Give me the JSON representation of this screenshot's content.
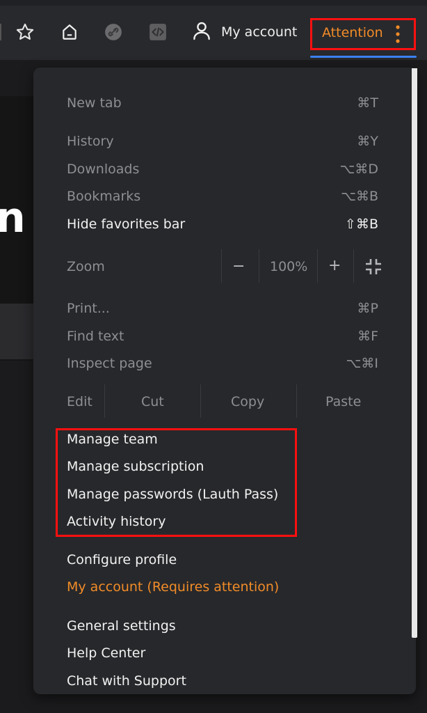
{
  "toolbar": {
    "account_label": "My account",
    "attention_label": "Attention"
  },
  "page": {
    "glyph": "n"
  },
  "menu": {
    "new_tab": {
      "label": "New tab",
      "shortcut": "⌘T"
    },
    "history": {
      "label": "History",
      "shortcut": "⌘Y"
    },
    "downloads": {
      "label": "Downloads",
      "shortcut": "⌥⌘D"
    },
    "bookmarks": {
      "label": "Bookmarks",
      "shortcut": "⌥⌘B"
    },
    "hide_favorites": {
      "label": "Hide favorites bar",
      "shortcut": "⇧⌘B"
    },
    "zoom": {
      "label": "Zoom",
      "minus": "−",
      "value": "100%",
      "plus": "+"
    },
    "print": {
      "label": "Print...",
      "shortcut": "⌘P"
    },
    "find": {
      "label": "Find text",
      "shortcut": "⌘F"
    },
    "inspect": {
      "label": "Inspect page",
      "shortcut": "⌥⌘I"
    },
    "edit": {
      "label": "Edit",
      "cut": "Cut",
      "copy": "Copy",
      "paste": "Paste"
    },
    "manage_team": "Manage team",
    "manage_subscription": "Manage subscription",
    "manage_passwords": "Manage passwords (Lauth Pass)",
    "activity_history": "Activity history",
    "configure_profile": "Configure profile",
    "my_account_attention": "My account (Requires attention)",
    "general_settings": "General settings",
    "help_center": "Help Center",
    "chat_support": "Chat with Support"
  },
  "colors": {
    "attention": "#f28c28",
    "highlight_box": "#ff1010",
    "underline": "#3b82f6"
  }
}
